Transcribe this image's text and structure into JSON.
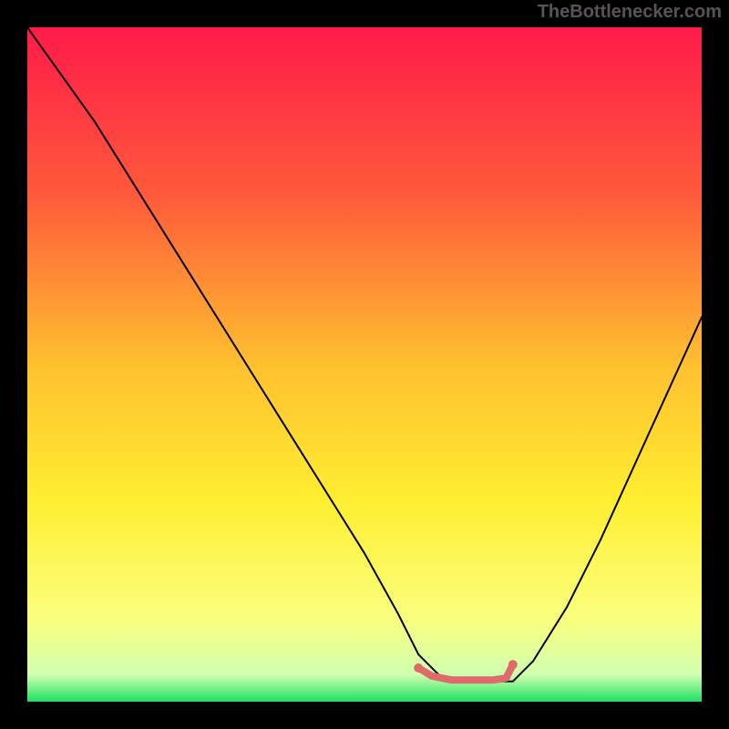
{
  "watermark": "TheBottlenecker.com",
  "chart_data": {
    "type": "line",
    "title": "",
    "xlabel": "",
    "ylabel": "",
    "xlim": [
      0,
      100
    ],
    "ylim": [
      0,
      100
    ],
    "background_gradient": {
      "stops": [
        {
          "offset": 0,
          "color": "#ff1a4a"
        },
        {
          "offset": 25,
          "color": "#ff5a3a"
        },
        {
          "offset": 50,
          "color": "#ffc030"
        },
        {
          "offset": 70,
          "color": "#ffee30"
        },
        {
          "offset": 88,
          "color": "#faff80"
        },
        {
          "offset": 96,
          "color": "#d0ffb0"
        },
        {
          "offset": 100,
          "color": "#20e060"
        }
      ]
    },
    "series": [
      {
        "name": "bottleneck-curve",
        "color": "#000000",
        "width": 2,
        "x": [
          0,
          5,
          10,
          15,
          20,
          25,
          30,
          35,
          40,
          45,
          50,
          55,
          58,
          62,
          68,
          72,
          75,
          80,
          85,
          90,
          95,
          100
        ],
        "y": [
          100,
          93,
          86,
          78,
          70,
          62,
          54,
          46,
          38,
          30,
          22,
          13,
          7,
          3,
          3,
          3,
          6,
          14,
          24,
          35,
          46,
          57
        ]
      },
      {
        "name": "optimal-range-marker",
        "color": "#e06a6a",
        "width": 8,
        "x": [
          58,
          60,
          63,
          66,
          69,
          71,
          72
        ],
        "y": [
          5.0,
          3.8,
          3.2,
          3.2,
          3.2,
          3.5,
          5.5
        ]
      }
    ],
    "markers": [
      {
        "name": "optimal-start-dot",
        "x": 58,
        "y": 5.0,
        "r": 5,
        "color": "#e06a6a"
      },
      {
        "name": "optimal-end-dot",
        "x": 72,
        "y": 5.5,
        "r": 5,
        "color": "#e06a6a"
      }
    ]
  }
}
